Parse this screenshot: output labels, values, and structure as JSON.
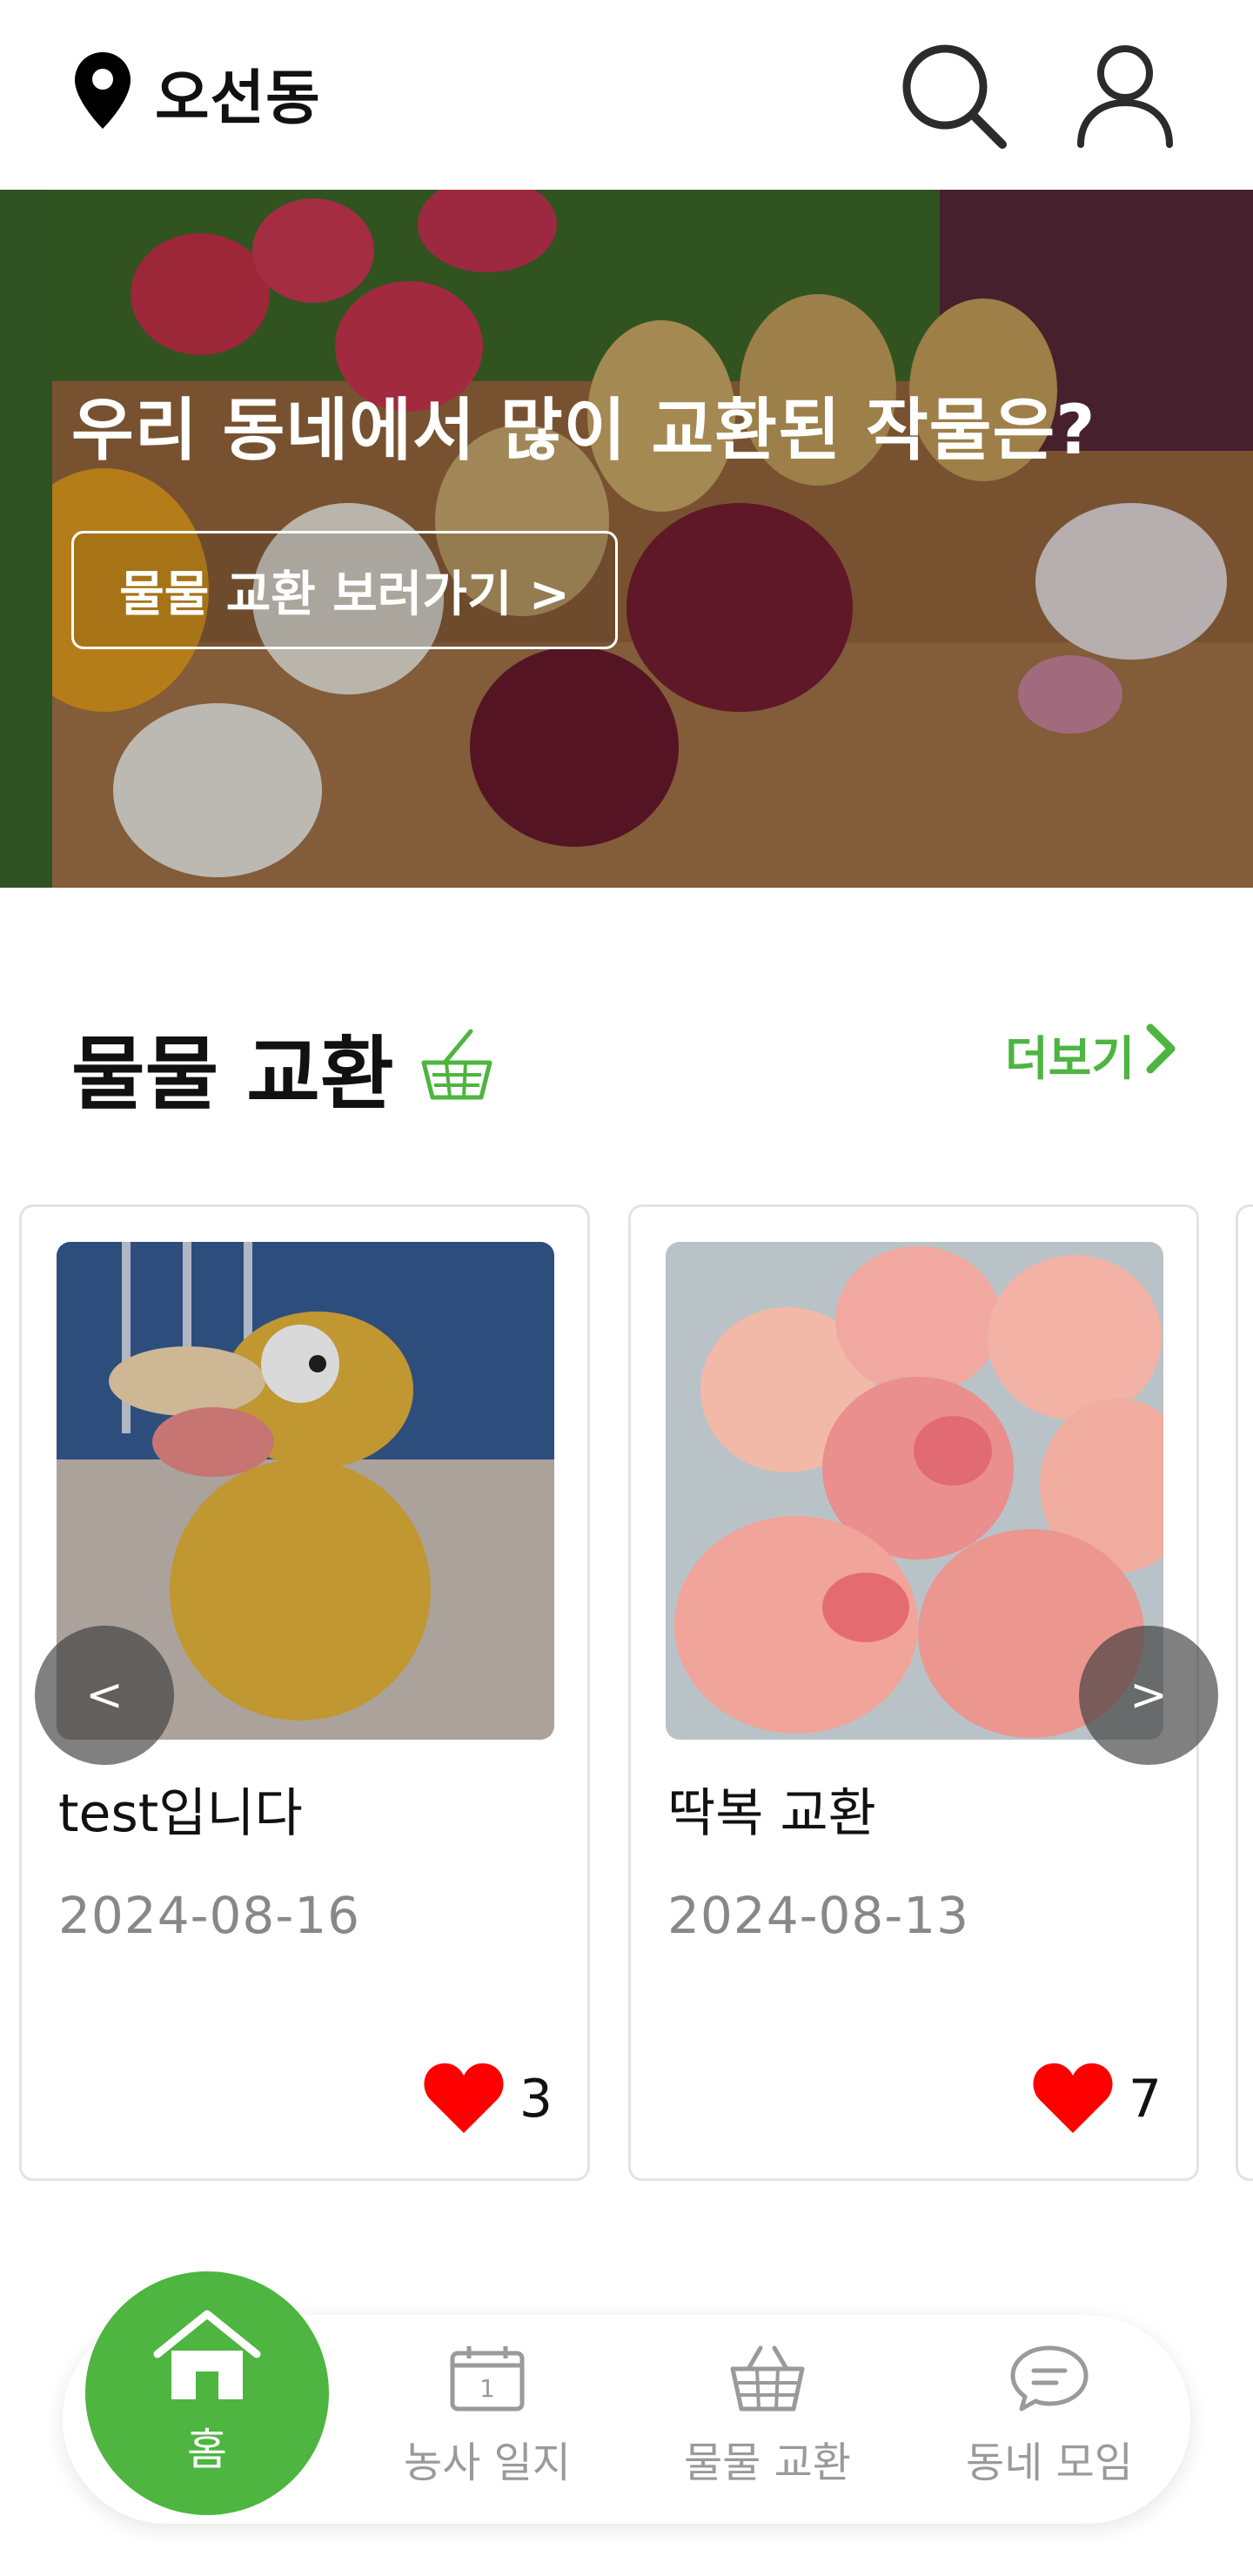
{
  "header": {
    "location": "오선동",
    "icons": {
      "location": "location-pin-icon",
      "search": "search-icon",
      "profile": "user-icon"
    }
  },
  "banner": {
    "title": "우리 동네에서 많이 교환된 작물은?",
    "button": "물물 교환 보러가기 >"
  },
  "section": {
    "title": "물물 교환",
    "more": "더보기",
    "icons": {
      "section": "basket-icon",
      "more": "chevron-right-icon"
    }
  },
  "cards": [
    {
      "title": "test입니다",
      "date": "2024-08-16",
      "likes": "3"
    },
    {
      "title": "딱복 교환",
      "date": "2024-08-13",
      "likes": "7"
    }
  ],
  "carousel": {
    "prev": "<",
    "next": ">"
  },
  "nav": {
    "home": "홈",
    "items": [
      "농사 일지",
      "물물 교환",
      "동네 모임"
    ],
    "icons": [
      "home-icon",
      "calendar-icon",
      "basket-icon",
      "chat-icon"
    ]
  },
  "colors": {
    "accent": "#4db540",
    "like": "#ff0000",
    "muted": "#888888"
  }
}
